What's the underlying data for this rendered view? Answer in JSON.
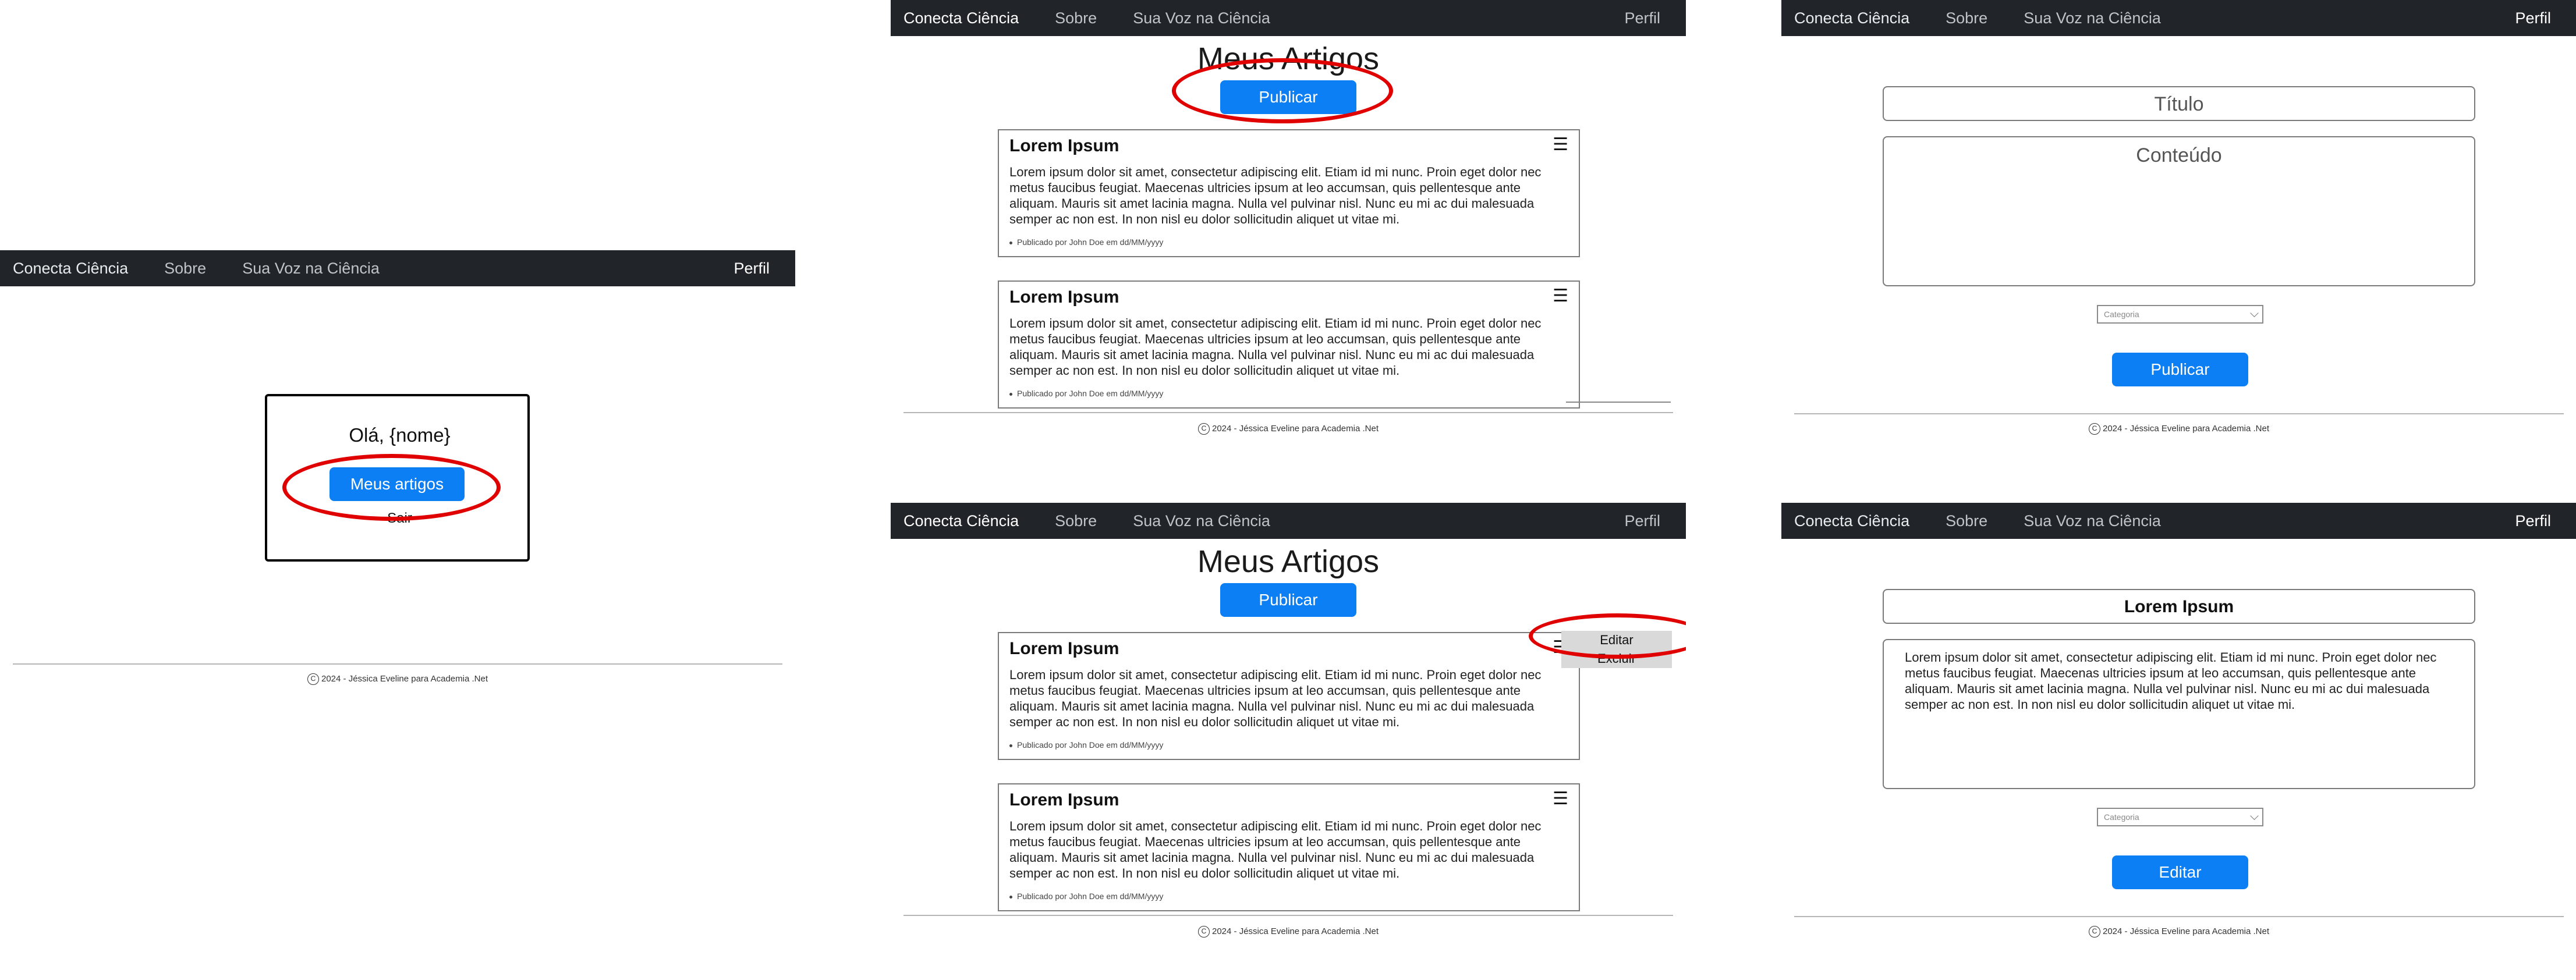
{
  "nav": {
    "brand": "Conecta Ciência",
    "about": "Sobre",
    "voice": "Sua Voz na Ciência",
    "profile": "Perfil"
  },
  "footer": {
    "copyright_symbol": "C",
    "text": "2024 - Jéssica Eveline para Academia .Net"
  },
  "profile_menu": {
    "greeting": "Olá, {nome}",
    "my_articles_button": "Meus artigos",
    "logout": "Sair"
  },
  "my_articles": {
    "title": "Meus Artigos",
    "publish_button": "Publicar",
    "menu_icon": "☰",
    "articles": [
      {
        "title": "Lorem Ipsum",
        "body": "Lorem ipsum dolor sit amet, consectetur adipiscing elit. Etiam id mi nunc. Proin eget dolor nec metus faucibus feugiat. Maecenas ultricies ipsum at leo accumsan, quis pellentesque ante aliquam. Mauris sit amet lacinia magna. Nulla vel pulvinar nisl. Nunc eu mi ac dui malesuada semper ac non est. In non nisl eu dolor sollicitudin aliquet ut vitae mi.",
        "meta": "Publicado por John Doe em dd/MM/yyyy"
      },
      {
        "title": "Lorem Ipsum",
        "body": "Lorem ipsum dolor sit amet, consectetur adipiscing elit. Etiam id mi nunc. Proin eget dolor nec metus faucibus feugiat. Maecenas ultricies ipsum at leo accumsan, quis pellentesque ante aliquam. Mauris sit amet lacinia magna. Nulla vel pulvinar nisl. Nunc eu mi ac dui malesuada semper ac non est. In non nisl eu dolor sollicitudin aliquet ut vitae mi.",
        "meta": "Publicado por John Doe em dd/MM/yyyy"
      }
    ],
    "dropdown": {
      "edit": "Editar",
      "delete": "Excluir"
    }
  },
  "new_article_form": {
    "title_placeholder": "Título",
    "content_placeholder": "Conteúdo",
    "category_placeholder": "Categoria",
    "submit_button": "Publicar"
  },
  "edit_article_form": {
    "title_value": "Lorem Ipsum",
    "content_value": "Lorem ipsum dolor sit amet, consectetur adipiscing elit. Etiam id mi nunc. Proin eget dolor nec metus faucibus feugiat. Maecenas ultricies ipsum at leo accumsan, quis pellentesque ante aliquam. Mauris sit amet lacinia magna. Nulla vel pulvinar nisl. Nunc eu mi ac dui malesuada semper ac non est. In non nisl eu dolor sollicitudin aliquet ut vitae mi.",
    "category_placeholder": "Categoria",
    "submit_button": "Editar"
  },
  "colors": {
    "navbar": "#212529",
    "primary": "#0d7ff5",
    "annotation": "#e00000"
  }
}
